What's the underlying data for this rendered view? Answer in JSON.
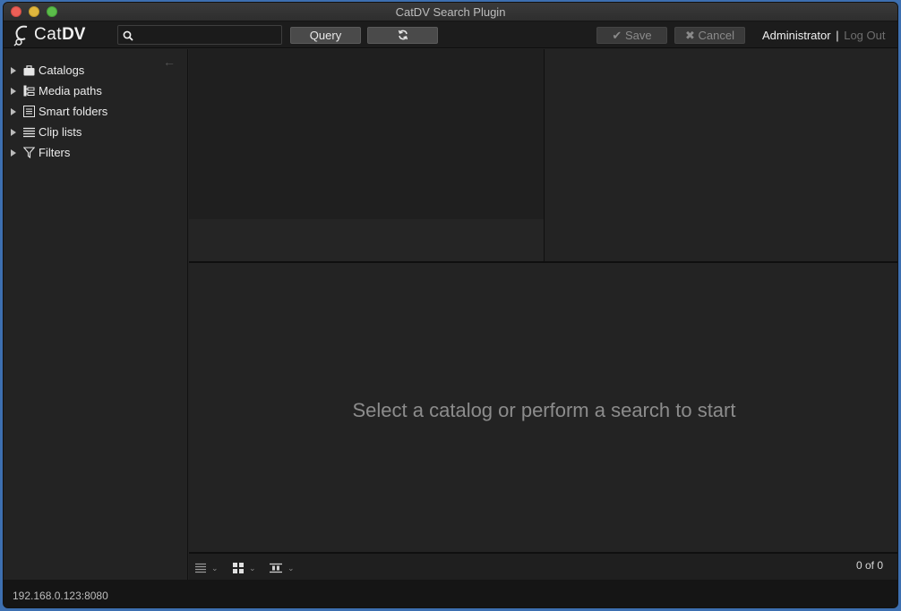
{
  "window": {
    "title": "CatDV Search Plugin"
  },
  "toolbar": {
    "logo_cat": "Cat",
    "logo_dv": "DV",
    "search_value": "",
    "query_label": "Query",
    "save_label": "Save",
    "cancel_label": "Cancel",
    "user_name": "Administrator",
    "separator": "|",
    "logout_label": "Log Out"
  },
  "sidebar": {
    "items": [
      {
        "label": "Catalogs",
        "icon": "briefcase-icon"
      },
      {
        "label": "Media paths",
        "icon": "tree-hierarchy-icon"
      },
      {
        "label": "Smart folders",
        "icon": "smart-folder-icon"
      },
      {
        "label": "Clip lists",
        "icon": "list-icon"
      },
      {
        "label": "Filters",
        "icon": "funnel-icon"
      }
    ]
  },
  "main": {
    "empty_message": "Select a catalog or perform a search to start",
    "count_label": "0 of 0"
  },
  "status": {
    "server": "192.168.0.123:8080"
  },
  "colors": {
    "background": "#232323",
    "toolbar": "#1c1c1c",
    "accent_blue": "#3d6fb0"
  }
}
